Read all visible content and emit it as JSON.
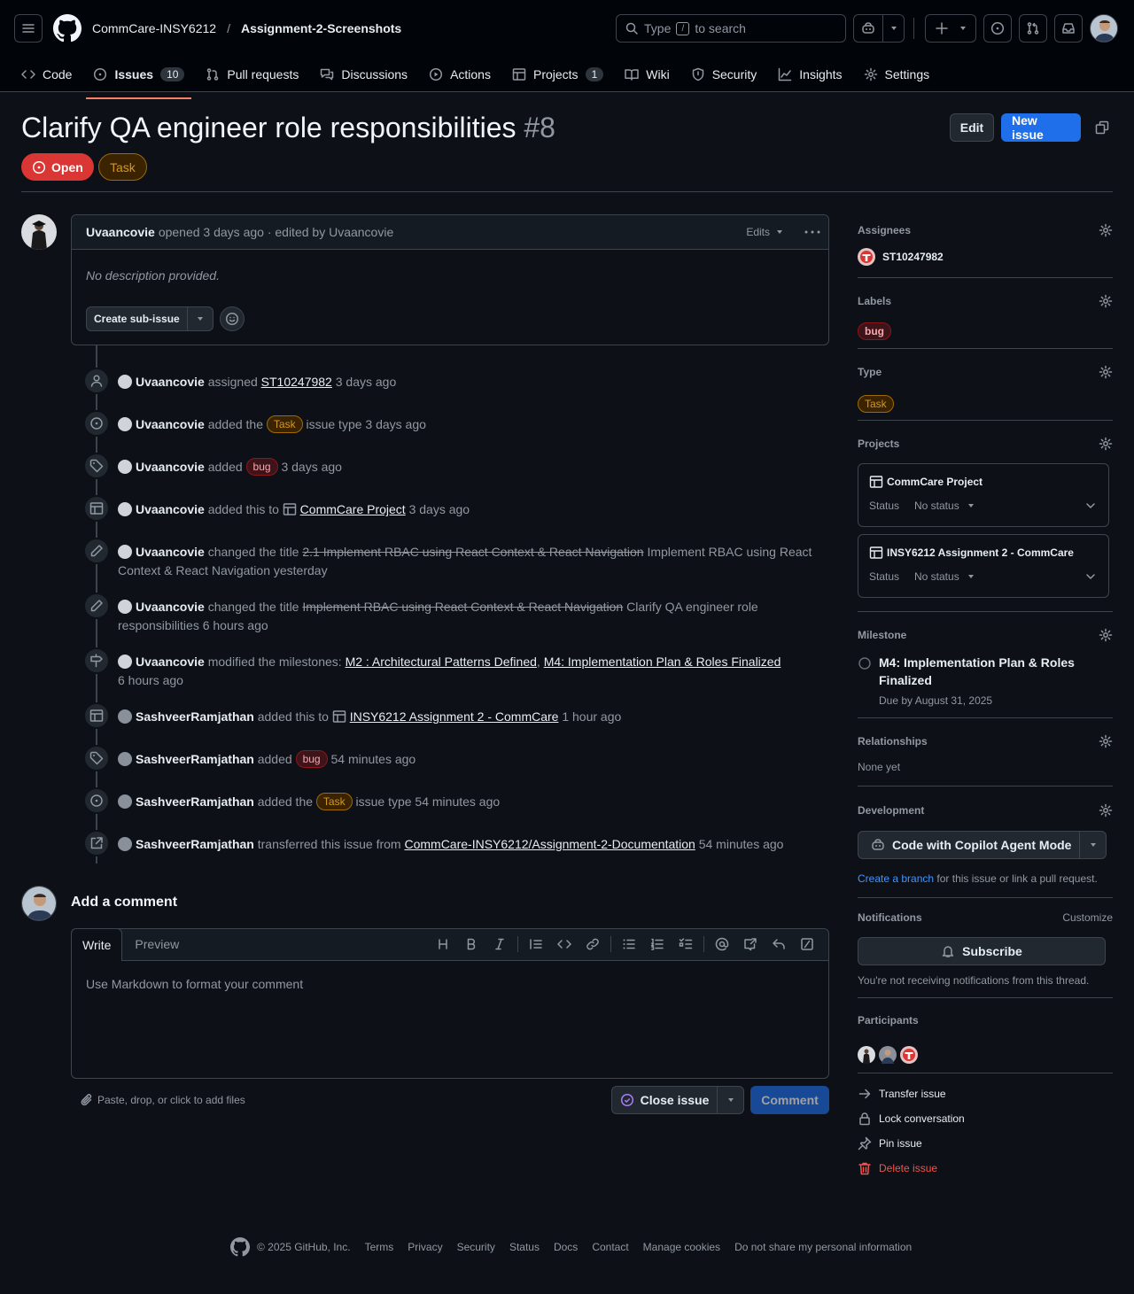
{
  "header": {
    "org": "CommCare-INSY6212",
    "separator": "/",
    "repo": "Assignment-2-Screenshots",
    "search_prefix": "Type",
    "search_key": "/",
    "search_suffix": "to search"
  },
  "tabs": [
    {
      "label": "Code"
    },
    {
      "label": "Issues",
      "count": "10"
    },
    {
      "label": "Pull requests"
    },
    {
      "label": "Discussions"
    },
    {
      "label": "Actions"
    },
    {
      "label": "Projects",
      "count": "1"
    },
    {
      "label": "Wiki"
    },
    {
      "label": "Security"
    },
    {
      "label": "Insights"
    },
    {
      "label": "Settings"
    }
  ],
  "issue": {
    "title": "Clarify QA engineer role responsibilities",
    "number": "#8",
    "state": "Open",
    "type": "Task",
    "edit": "Edit",
    "new_issue": "New issue"
  },
  "comment": {
    "author": "Uvaancovie",
    "meta": "opened 3 days ago · edited by Uvaancovie",
    "edits": "Edits",
    "body": "No description provided.",
    "sub_issue": "Create sub-issue"
  },
  "events": {
    "e1": {
      "actor": "Uvaancovie",
      "t1": "assigned",
      "link": "ST10247982",
      "t2": "3 days ago"
    },
    "e2": {
      "actor": "Uvaancovie",
      "t1": "added the",
      "pill": "Task",
      "t2": "issue type 3 days ago"
    },
    "e3": {
      "actor": "Uvaancovie",
      "t1": "added",
      "pill": "bug",
      "t2": "3 days ago"
    },
    "e4": {
      "actor": "Uvaancovie",
      "t1": "added this to",
      "link": "CommCare Project",
      "t2": "3 days ago"
    },
    "e5": {
      "actor": "Uvaancovie",
      "t1": "changed the title",
      "old": "2.1 Implement RBAC using React Context & React Navigation",
      "new": "Implement RBAC using React Context & React Navigation",
      "t2": "yesterday"
    },
    "e6": {
      "actor": "Uvaancovie",
      "t1": "changed the title",
      "old": "Implement RBAC using React Context & React Navigation",
      "new": "Clarify QA engineer role responsibilities",
      "t2": "6 hours ago"
    },
    "e7": {
      "actor": "Uvaancovie",
      "t1": "modified the milestones:",
      "link1": "M2 : Architectural Patterns Defined",
      "sep": ",",
      "link2": "M4: Implementation Plan & Roles Finalized",
      "t2": "6 hours ago"
    },
    "e8": {
      "actor": "SashveerRamjathan",
      "t1": "added this to",
      "link": "INSY6212 Assignment 2 - CommCare",
      "t2": "1 hour ago"
    },
    "e9": {
      "actor": "SashveerRamjathan",
      "t1": "added",
      "pill": "bug",
      "t2": "54 minutes ago"
    },
    "e10": {
      "actor": "SashveerRamjathan",
      "t1": "added the",
      "pill": "Task",
      "t2": "issue type 54 minutes ago"
    },
    "e11": {
      "actor": "SashveerRamjathan",
      "t1": "transferred this issue from",
      "link": "CommCare-INSY6212/Assignment-2-Documentation",
      "t2": "54 minutes ago"
    }
  },
  "add_comment": {
    "heading": "Add a comment",
    "write": "Write",
    "preview": "Preview",
    "placeholder": "Use Markdown to format your comment",
    "attach": "Paste, drop, or click to add files",
    "close": "Close issue",
    "submit": "Comment"
  },
  "sidebar": {
    "assignees": {
      "label": "Assignees",
      "user": "ST10247982"
    },
    "labels": {
      "label": "Labels",
      "value": "bug"
    },
    "type": {
      "label": "Type",
      "value": "Task"
    },
    "projects": {
      "label": "Projects",
      "status_label": "Status",
      "items": [
        {
          "name": "CommCare Project",
          "status": "No status"
        },
        {
          "name": "INSY6212 Assignment 2 - CommCare",
          "status": "No status"
        }
      ]
    },
    "milestone": {
      "label": "Milestone",
      "name": "M4: Implementation Plan & Roles Finalized",
      "due": "Due by August 31, 2025"
    },
    "relationships": {
      "label": "Relationships",
      "value": "None yet"
    },
    "development": {
      "label": "Development",
      "button": "Code with Copilot Agent Mode",
      "link": "Create a branch",
      "text": "for this issue or link a pull request."
    },
    "notifications": {
      "label": "Notifications",
      "customize": "Customize",
      "button": "Subscribe",
      "text": "You're not receiving notifications from this thread."
    },
    "participants": {
      "label": "Participants"
    },
    "actions": {
      "transfer": "Transfer issue",
      "lock": "Lock conversation",
      "pin": "Pin issue",
      "delete": "Delete issue"
    }
  },
  "footer": {
    "copyright": "© 2025 GitHub, Inc.",
    "links": [
      "Terms",
      "Privacy",
      "Security",
      "Status",
      "Docs",
      "Contact",
      "Manage cookies",
      "Do not share my personal information"
    ]
  },
  "colors": {
    "bg": "#0d1117",
    "header_bg": "#010409",
    "border": "#3d444d",
    "open_red": "#da3633",
    "accent_blue": "#1f6feb",
    "tab_underline": "#f78166",
    "task_orange": "#d29922",
    "danger": "#f85149"
  }
}
